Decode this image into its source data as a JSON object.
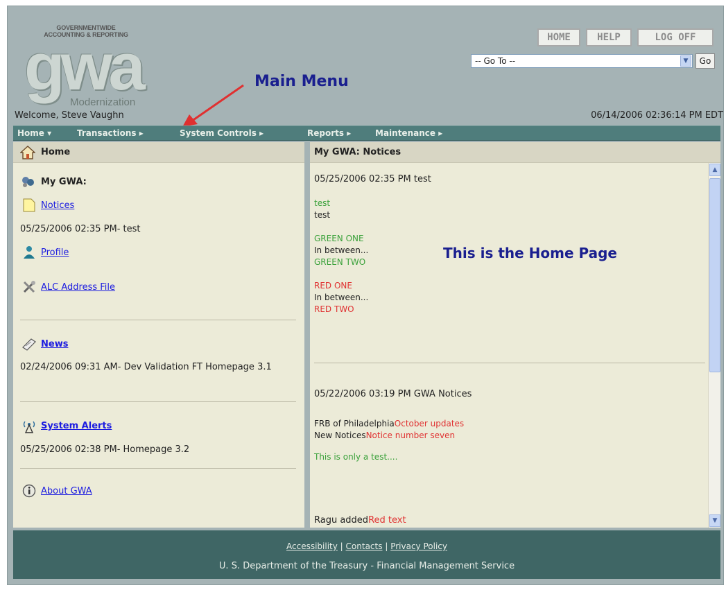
{
  "header": {
    "logo": {
      "gov_line1": "GOVERNMENTWIDE",
      "gov_line2": "ACCOUNTING & REPORTING",
      "wordmark": "gwa",
      "subtitle": "Modernization"
    },
    "buttons": {
      "home": "HOME",
      "help": "HELP",
      "logoff": "LOG OFF"
    },
    "goto": {
      "selected": "-- Go To --",
      "button": "Go"
    },
    "welcome": "Welcome, Steve Vaughn",
    "datetime": "06/14/2006 02:36:14 PM EDT"
  },
  "annotations": {
    "main_menu": "Main Menu",
    "home_page": "This is the Home Page",
    "arrow_color": "#e03030"
  },
  "nav": {
    "items": [
      {
        "label": "Home",
        "suffix": "▾"
      },
      {
        "label": "Transactions",
        "suffix": "▸"
      },
      {
        "label": "System Controls",
        "suffix": "▸"
      },
      {
        "label": "Reports",
        "suffix": "▸"
      },
      {
        "label": "Maintenance",
        "suffix": "▸"
      }
    ]
  },
  "left": {
    "title": "Home",
    "my_gwa": "My GWA:",
    "notices_link": "Notices",
    "notice_entry": "05/25/2006 02:35 PM- test",
    "profile_link": "Profile",
    "alc_link": "ALC Address File",
    "news_link": "News",
    "news_entry": "02/24/2006 09:31 AM- Dev Validation FT Homepage 3.1",
    "alerts_link": "System Alerts",
    "alerts_entry": "05/25/2006 02:38 PM- Homepage 3.2",
    "about_link": "About GWA",
    "icons": [
      "home-icon",
      "my-gwa-icon",
      "notice-page-icon",
      "profile-person-icon",
      "tools-icon",
      "news-icon",
      "antenna-icon",
      "info-icon"
    ]
  },
  "right": {
    "title": "My GWA: Notices",
    "notice1": {
      "header": "05/25/2006 02:35 PM   test",
      "line_green": "test",
      "line_black": "test",
      "green_one": "GREEN ONE",
      "between1": "In between...",
      "green_two": "GREEN TWO",
      "red_one": "RED ONE",
      "between2": "In between...",
      "red_two": "RED TWO"
    },
    "notice2": {
      "header": "05/22/2006 03:19 PM   GWA Notices",
      "frb_prefix": "FRB of Philadelphia",
      "frb_red": "October updates",
      "new_prefix": "New Notices",
      "new_red": "Notice number seven",
      "test_line": "This is only a test....",
      "ragu_prefix": "Ragu added",
      "ragu_red": "Red text"
    }
  },
  "footer": {
    "links": [
      "Accessibility",
      "Contacts",
      "Privacy Policy"
    ],
    "separator": "|",
    "text": "U. S. Department of the Treasury - Financial Management Service"
  },
  "colors": {
    "navbar": "#4f7d7c",
    "footer": "#3f6665",
    "panel": "#ecebd8",
    "link": "#1c1ce0",
    "green_text": "#3aa13a",
    "red_text": "#e03232"
  }
}
